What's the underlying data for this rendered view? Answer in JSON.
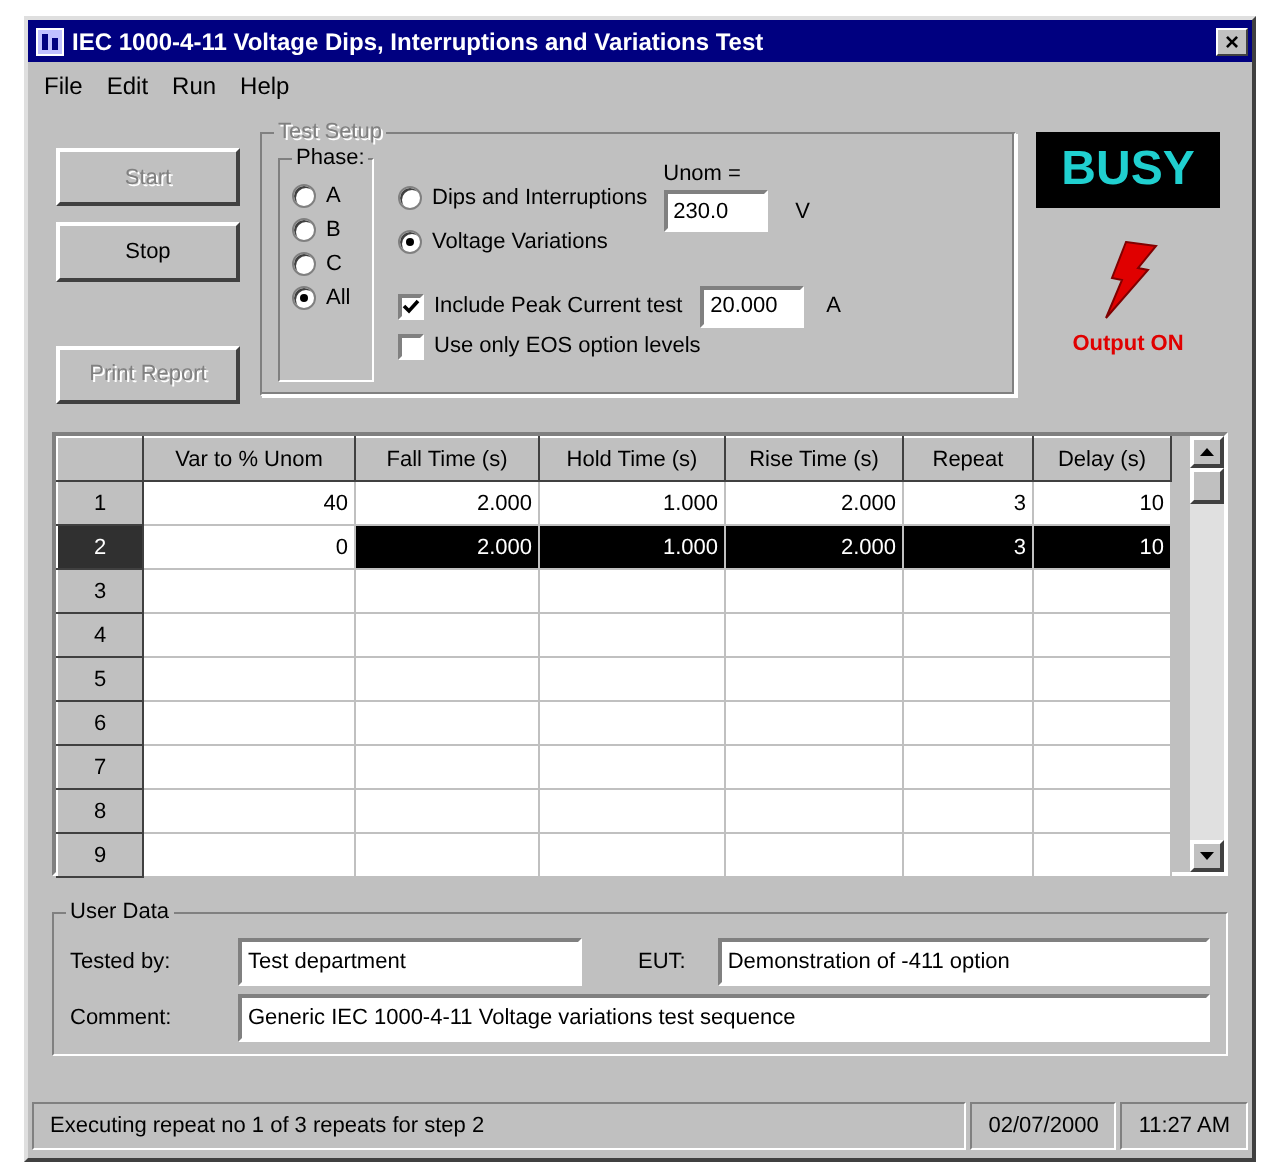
{
  "window": {
    "title": "IEC 1000-4-11 Voltage Dips, Interruptions and Variations Test",
    "close": "×"
  },
  "menu": [
    "File",
    "Edit",
    "Run",
    "Help"
  ],
  "buttons": [
    {
      "label": "Start",
      "disabled": true
    },
    {
      "label": "Stop",
      "disabled": false
    },
    {
      "label": "Print Report",
      "disabled": true
    }
  ],
  "test_setup": {
    "title": "Test Setup",
    "phase": {
      "title": "Phase:",
      "options": [
        {
          "label": "A",
          "selected": false
        },
        {
          "label": "B",
          "selected": false
        },
        {
          "label": "C",
          "selected": false
        },
        {
          "label": "All",
          "selected": true
        }
      ]
    },
    "modes": [
      {
        "label": "Dips and Interruptions",
        "selected": false
      },
      {
        "label": "Voltage Variations",
        "selected": true
      }
    ],
    "unom": {
      "label": "Unom =",
      "value": "230.0",
      "unit": "V"
    },
    "options": [
      {
        "label": "Include Peak Current test",
        "checked": true,
        "value": "20.000",
        "unit": "A"
      },
      {
        "label": "Use only  EOS option levels",
        "checked": false
      }
    ]
  },
  "status": {
    "indicator": "BUSY",
    "output": "Output ON"
  },
  "table": {
    "columns": [
      "Var to % Unom",
      "Fall Time (s)",
      "Hold Time (s)",
      "Rise Time (s)",
      "Repeat",
      "Delay (s)"
    ],
    "rows": [
      {
        "number": "1",
        "selected": false,
        "cells": [
          {
            "text": "40",
            "selected": false
          },
          {
            "text": "2.000",
            "selected": false
          },
          {
            "text": "1.000",
            "selected": false
          },
          {
            "text": "2.000",
            "selected": false
          },
          {
            "text": "3",
            "selected": false
          },
          {
            "text": "10",
            "selected": false
          }
        ]
      },
      {
        "number": "2",
        "selected": true,
        "cells": [
          {
            "text": "0",
            "selected": false
          },
          {
            "text": "2.000",
            "selected": true
          },
          {
            "text": "1.000",
            "selected": true
          },
          {
            "text": "2.000",
            "selected": true
          },
          {
            "text": "3",
            "selected": true
          },
          {
            "text": "10",
            "selected": true
          }
        ]
      },
      {
        "number": "3",
        "selected": false
      },
      {
        "number": "4",
        "selected": false
      },
      {
        "number": "5",
        "selected": false
      },
      {
        "number": "6",
        "selected": false
      },
      {
        "number": "7",
        "selected": false
      },
      {
        "number": "8",
        "selected": false
      },
      {
        "number": "9",
        "selected": false
      }
    ]
  },
  "user_data": {
    "title": "User Data",
    "tested_by": {
      "label": "Tested by:",
      "value": "Test department"
    },
    "eut": {
      "label": "EUT:",
      "value": "Demonstration of -411 option"
    },
    "comment": {
      "label": "Comment:",
      "value": "Generic IEC 1000-4-11 Voltage variations test sequence"
    }
  },
  "status_bar": [
    "Executing repeat no 1 of 3 repeats for step 2",
    "02/07/2000",
    "11:27 AM"
  ]
}
